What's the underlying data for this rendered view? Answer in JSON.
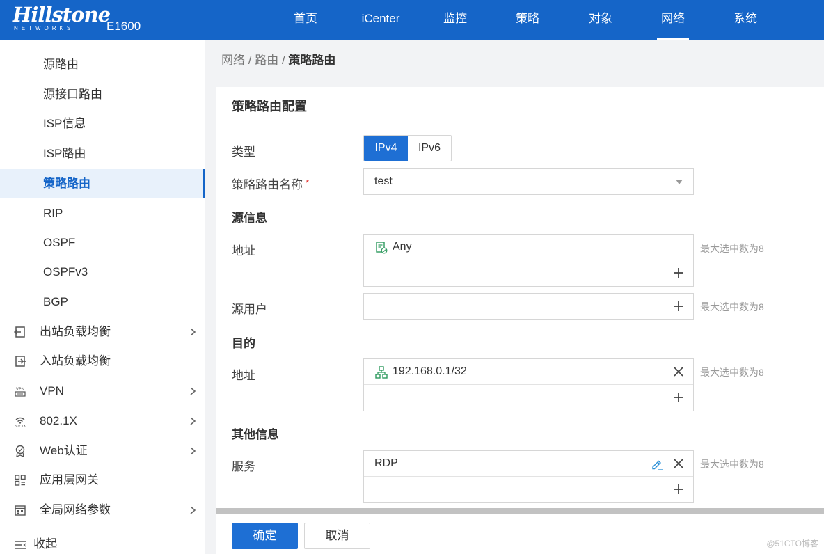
{
  "header": {
    "logo_main": "Hillstone",
    "logo_sub": "NETWORKS",
    "model": "E1600",
    "nav": [
      "首页",
      "iCenter",
      "监控",
      "策略",
      "对象",
      "网络",
      "系统"
    ],
    "active_nav": "网络"
  },
  "sidebar": {
    "items": [
      "源路由",
      "源接口路由",
      "ISP信息",
      "ISP路由",
      "策略路由",
      "RIP",
      "OSPF",
      "OSPFv3",
      "BGP"
    ],
    "active_item": "策略路由",
    "groups": [
      {
        "label": "出站负载均衡",
        "icon": "outbound-icon",
        "expandable": true
      },
      {
        "label": "入站负载均衡",
        "icon": "inbound-icon",
        "expandable": false
      },
      {
        "label": "VPN",
        "icon": "vpn-icon",
        "expandable": true
      },
      {
        "label": "802.1X",
        "icon": "wifi-icon",
        "expandable": true
      },
      {
        "label": "Web认证",
        "icon": "badge-icon",
        "expandable": true
      },
      {
        "label": "应用层网关",
        "icon": "grid-icon",
        "expandable": false
      },
      {
        "label": "全局网络参数",
        "icon": "global-params-icon",
        "expandable": true
      }
    ],
    "collapse_label": "收起"
  },
  "breadcrumb": {
    "parts": [
      "网络",
      "路由"
    ],
    "separator": "/",
    "current": "策略路由"
  },
  "form": {
    "title": "策略路由配置",
    "type_label": "类型",
    "type_options": [
      "IPv4",
      "IPv6"
    ],
    "type_selected": "IPv4",
    "name_label": "策略路由名称",
    "required_mark": "*",
    "name_value": "test",
    "section_source": "源信息",
    "src_address_label": "地址",
    "src_address_value": "Any",
    "src_user_label": "源用户",
    "section_dest": "目的",
    "dst_address_label": "地址",
    "dst_address_value": "192.168.0.1/32",
    "section_other": "其他信息",
    "service_label": "服务",
    "service_value": "RDP",
    "max_hint": "最大选中数为8"
  },
  "footer": {
    "ok_label": "确定",
    "cancel_label": "取消",
    "watermark": "@51CTO博客"
  },
  "colors": {
    "brand": "#1565c8",
    "primary_button": "#1e6fd4",
    "address_icon": "#2e9a5e",
    "edit_icon": "#2a8fd6"
  }
}
